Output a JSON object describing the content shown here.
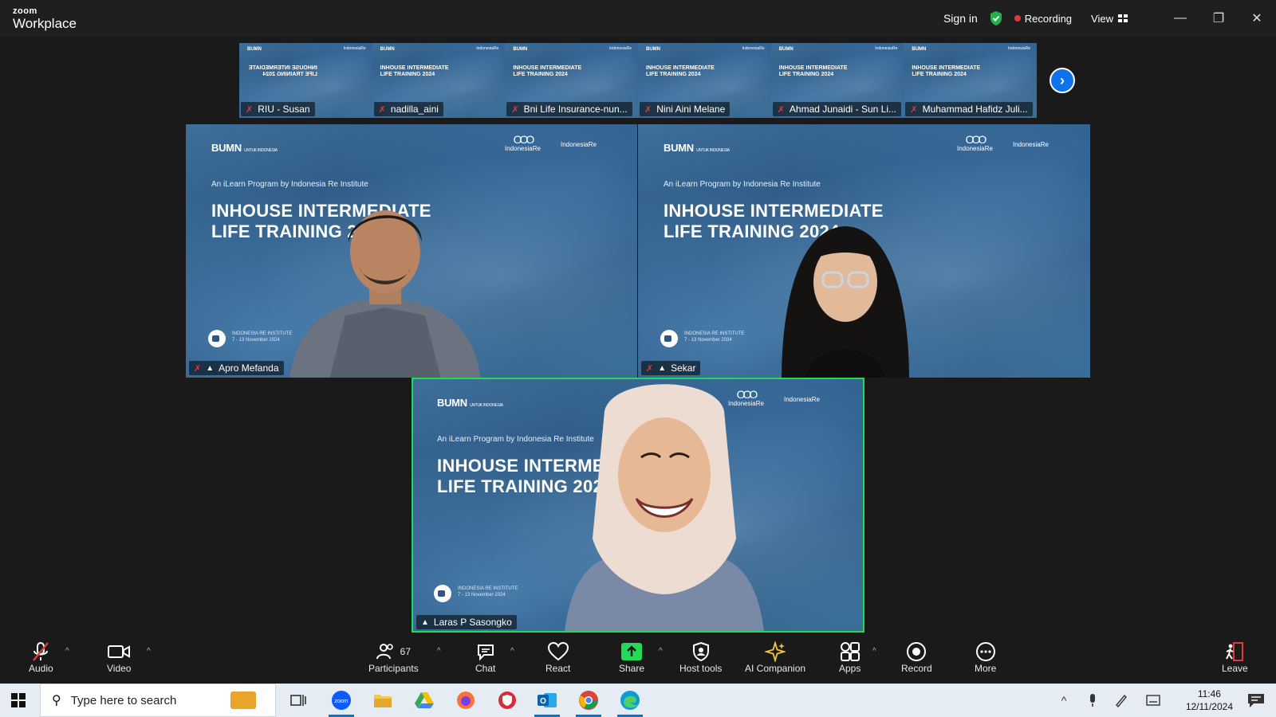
{
  "app": {
    "logo_small": "zoom",
    "logo_big": "Workplace",
    "sign_in": "Sign in",
    "recording": "Recording",
    "view": "View"
  },
  "thumbnails": [
    {
      "name": "RIU - Susan",
      "title": "INHOUSE INTERMEDIATE\nLIFE TRAINING 2024"
    },
    {
      "name": "nadilla_aini",
      "title": "INHOUSE INTERMEDIATE\nLIFE TRAINING 2024"
    },
    {
      "name": "Bni Life Insurance-nun...",
      "title": "INHOUSE INTERMEDIATE\nLIFE TRAINING 2024"
    },
    {
      "name": "Nini Aini Melane",
      "title": "INHOUSE INTERMEDIATE\nLIFE TRAINING 2024"
    },
    {
      "name": "Ahmad Junaidi - Sun Li...",
      "title": "INHOUSE INTERMEDIATE\nLIFE TRAINING 2024"
    },
    {
      "name": "Muhammad Hafidz Juli...",
      "title": "INHOUSE INTERMEDIATE\nLIFE TRAINING 2024"
    }
  ],
  "background": {
    "brand": "BUMN",
    "brand_small": "UNTUK INDONESIA",
    "partner1": "IndonesiaRe",
    "partner2": "IndonesiaRe",
    "subhead": "An iLearn Program by Indonesia Re Institute",
    "headline1": "INHOUSE INTERMEDIATE",
    "headline2": "LIFE TRAINING 2024",
    "institute": "INDONESIA RE INSTITUTE",
    "dates": "7 - 13 November 2024"
  },
  "tiles": {
    "apro": {
      "name": "Apro Mefanda"
    },
    "sekar": {
      "name": "Sekar"
    },
    "laras": {
      "name": "Laras P Sasongko"
    }
  },
  "toolbar": {
    "audio": "Audio",
    "video": "Video",
    "participants": "Participants",
    "participants_count": "67",
    "chat": "Chat",
    "react": "React",
    "share": "Share",
    "host_tools": "Host tools",
    "ai_companion": "AI Companion",
    "apps": "Apps",
    "record": "Record",
    "more": "More",
    "leave": "Leave"
  },
  "taskbar": {
    "search_placeholder": "Type here to search",
    "time": "11:46",
    "date": "12/11/2024"
  },
  "colors": {
    "accent_blue": "#0e72ed",
    "active_speaker": "#23d959",
    "recording_red": "#e0393e",
    "share_green": "#23d959"
  }
}
